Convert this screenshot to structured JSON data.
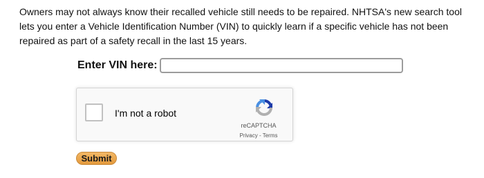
{
  "intro": {
    "text": "Owners may not always know their recalled vehicle still needs to be repaired. NHTSA's new search tool lets you enter a Vehicle Identification Number (VIN) to quickly learn if a specific vehicle has not been repaired as part of a safety recall in the last 15 years."
  },
  "vin": {
    "label": "Enter VIN here:",
    "value": "",
    "placeholder": ""
  },
  "recaptcha": {
    "checkbox_label": "I'm not a robot",
    "brand": "reCAPTCHA",
    "privacy_link": "Privacy",
    "separator": " - ",
    "terms_link": "Terms",
    "icon": "recaptcha-logo-icon",
    "checked": false
  },
  "submit": {
    "label": "Submit"
  },
  "colors": {
    "submit_bg": "#e9a64c",
    "recaptcha_blue": "#1c3aa9",
    "recaptcha_light_blue": "#4a90e2",
    "recaptcha_gray": "#b0b0b0"
  }
}
